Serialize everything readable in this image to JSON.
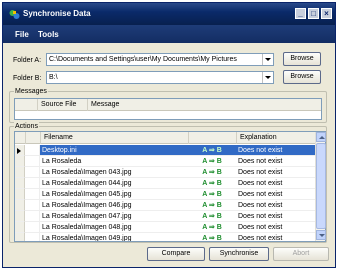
{
  "window": {
    "title": "Synchronise Data",
    "controls": {
      "minimize": "_",
      "maximize": "□",
      "close": "×"
    }
  },
  "menu": {
    "file": "File",
    "tools": "Tools"
  },
  "folder_a": {
    "label": "Folder A:",
    "value": "C:\\Documents and Settings\\user\\My Documents\\My Pictures",
    "browse": "Browse"
  },
  "folder_b": {
    "label": "Folder B:",
    "value": "B:\\",
    "browse": "Browse"
  },
  "messages": {
    "legend": "Messages",
    "columns": {
      "source": "Source File",
      "message": "Message"
    }
  },
  "actions": {
    "legend": "Actions",
    "columns": {
      "filename": "Filename",
      "explanation": "Explanation"
    },
    "rows": [
      {
        "filename": "Desktop.ini",
        "direction": "A ⇒ B",
        "explanation": "Does not exist"
      },
      {
        "filename": "La Rosaleda",
        "direction": "A ⇒ B",
        "explanation": "Does not exist"
      },
      {
        "filename": "La Rosaleda\\Imagen 043.jpg",
        "direction": "A ⇒ B",
        "explanation": "Does not exist"
      },
      {
        "filename": "La Rosaleda\\Imagen 044.jpg",
        "direction": "A ⇒ B",
        "explanation": "Does not exist"
      },
      {
        "filename": "La Rosaleda\\Imagen 045.jpg",
        "direction": "A ⇒ B",
        "explanation": "Does not exist"
      },
      {
        "filename": "La Rosaleda\\Imagen 046.jpg",
        "direction": "A ⇒ B",
        "explanation": "Does not exist"
      },
      {
        "filename": "La Rosaleda\\Imagen 047.jpg",
        "direction": "A ⇒ B",
        "explanation": "Does not exist"
      },
      {
        "filename": "La Rosaleda\\Imagen 048.jpg",
        "direction": "A ⇒ B",
        "explanation": "Does not exist"
      },
      {
        "filename": "La Rosaleda\\Imagen 049.jpg",
        "direction": "A ⇒ B",
        "explanation": "Does not exist"
      }
    ]
  },
  "buttons": {
    "compare": "Compare",
    "synchronise": "Synchronise",
    "abort": "Abort"
  },
  "icons": {
    "app": "sync-icon"
  },
  "colors": {
    "titlebar": "#0a2a6a",
    "selection": "#316ac5",
    "direction_arrow": "#1c8c2c"
  }
}
